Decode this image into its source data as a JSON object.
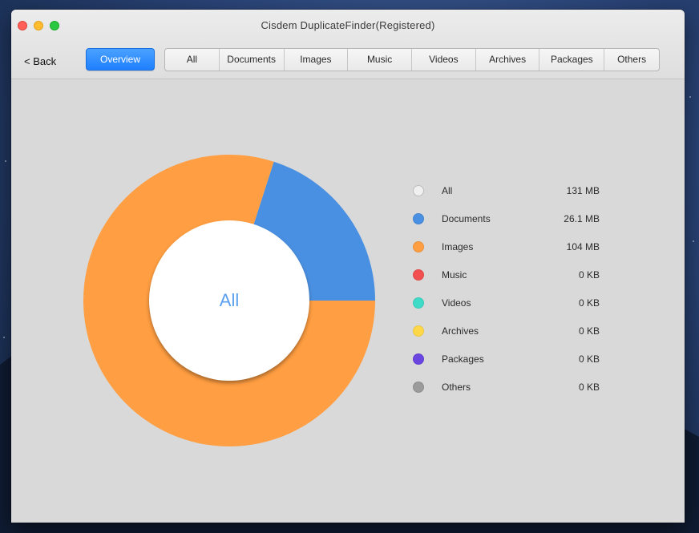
{
  "window": {
    "title": "Cisdem DuplicateFinder(Registered)"
  },
  "toolbar": {
    "back_label": "< Back",
    "overview_label": "Overview",
    "tabs": [
      "All",
      "Documents",
      "Images",
      "Music",
      "Videos",
      "Archives",
      "Packages",
      "Others"
    ]
  },
  "chart_data": {
    "type": "pie",
    "center_label": "All",
    "slices": [
      {
        "label": "Documents",
        "value": 26.1,
        "color": "#4a90e2"
      },
      {
        "label": "Images",
        "value": 104,
        "color": "#ff9e42"
      }
    ],
    "unit": "MB"
  },
  "legend": [
    {
      "name": "All",
      "size": "131 MB",
      "color": "#e6e6e6"
    },
    {
      "name": "Documents",
      "size": "26.1 MB",
      "color": "#4a90e2"
    },
    {
      "name": "Images",
      "size": "104 MB",
      "color": "#ff9e42"
    },
    {
      "name": "Music",
      "size": "0 KB",
      "color": "#f25050"
    },
    {
      "name": "Videos",
      "size": "0 KB",
      "color": "#3ddbc8"
    },
    {
      "name": "Archives",
      "size": "0 KB",
      "color": "#ffd84a"
    },
    {
      "name": "Packages",
      "size": "0 KB",
      "color": "#6a45e0"
    },
    {
      "name": "Others",
      "size": "0 KB",
      "color": "#9b9b9b"
    }
  ]
}
